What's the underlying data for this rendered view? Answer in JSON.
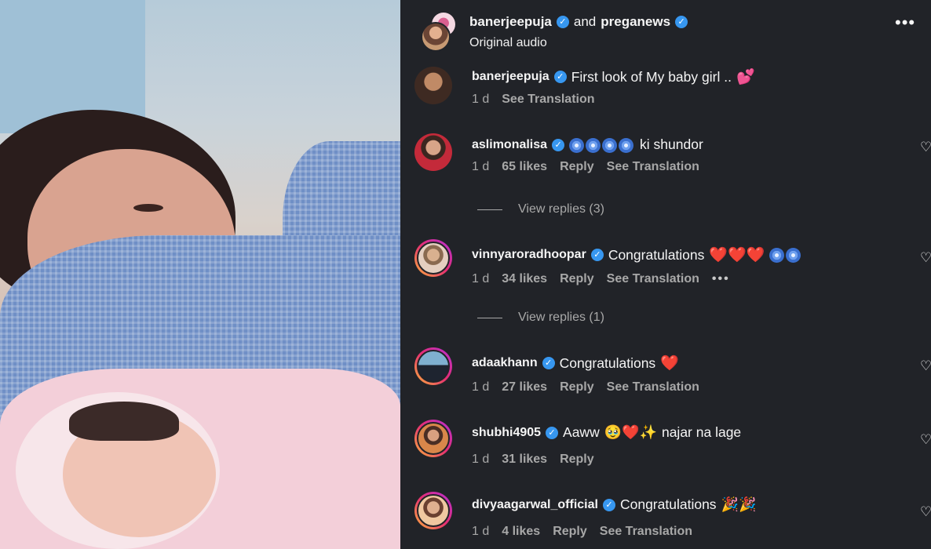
{
  "header": {
    "user1": "banerjeepuja",
    "and": "and",
    "user2": "preganews",
    "audio": "Original audio",
    "more": "•••"
  },
  "comments": [
    {
      "user": "banerjeepuja",
      "text": "First look of My baby girl ..",
      "emoji": "💕",
      "time": "1 d",
      "likes": "",
      "reply": "",
      "translate": "See Translation"
    },
    {
      "user": "aslimonalisa",
      "text": "ki shundor",
      "emoji": "🧿🧿🧿🧿",
      "time": "1 d",
      "likes": "65 likes",
      "reply": "Reply",
      "translate": "See Translation",
      "view_replies": "View replies (3)"
    },
    {
      "user": "vinnyaroradhoopar",
      "text": "Congratulations",
      "emoji": "❤️❤️❤️🧿🧿",
      "time": "1 d",
      "likes": "34 likes",
      "reply": "Reply",
      "translate": "See Translation",
      "extra": "•••",
      "view_replies": "View replies (1)"
    },
    {
      "user": "adaakhann",
      "text": "Congratulations",
      "emoji": "❤️",
      "time": "1 d",
      "likes": "27 likes",
      "reply": "Reply",
      "translate": "See Translation"
    },
    {
      "user": "shubhi4905",
      "text_before": "Aaww",
      "emoji": "🥹❤️✨",
      "text": "najar na lage",
      "time": "1 d",
      "likes": "31 likes",
      "reply": "Reply"
    },
    {
      "user": "divyaagarwal_official",
      "text": "Congratulations",
      "emoji": "🎉🎉",
      "time": "1 d",
      "likes": "4 likes",
      "reply": "Reply",
      "translate": "See Translation"
    }
  ],
  "colors": {
    "background": "#212328",
    "verified": "#3797f0",
    "muted": "#a8a8a8",
    "heart": "#ff3b6b"
  }
}
